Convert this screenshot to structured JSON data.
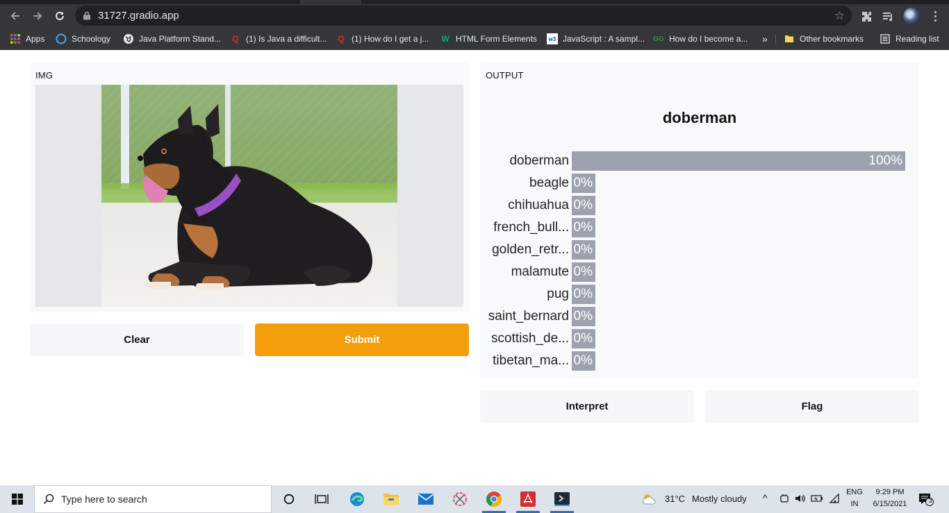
{
  "browser": {
    "url": "31727.gradio.app",
    "bookmarks": [
      {
        "label": "Apps",
        "icon": "apps-grid-icon"
      },
      {
        "label": "Schoology",
        "icon": "schoology-icon"
      },
      {
        "label": "Java Platform Stand...",
        "icon": "globe-icon"
      },
      {
        "label": "(1) Is Java a difficult...",
        "icon": "quora-icon"
      },
      {
        "label": "(1) How do I get a j...",
        "icon": "quora-icon"
      },
      {
        "label": "HTML Form Elements",
        "icon": "w3-icon"
      },
      {
        "label": "JavaScript : A sampl...",
        "icon": "w3c-icon"
      },
      {
        "label": "How do I become a...",
        "icon": "gfg-icon"
      },
      {
        "label": "»",
        "icon": "overflow-chevron"
      },
      {
        "label": "Other bookmarks",
        "icon": "folder-icon"
      },
      {
        "label": "Reading list",
        "icon": "reading-list-icon"
      }
    ]
  },
  "app": {
    "input_label": "IMG",
    "output_label": "OUTPUT",
    "clear_label": "Clear",
    "submit_label": "Submit",
    "interpret_label": "Interpret",
    "flag_label": "Flag",
    "prediction": "doberman",
    "confidences": [
      {
        "label": "doberman",
        "value": 1.0,
        "text": "100%"
      },
      {
        "label": "beagle",
        "value": 0.0,
        "text": "0%"
      },
      {
        "label": "chihuahua",
        "value": 0.0,
        "text": "0%"
      },
      {
        "label": "french_bull...",
        "value": 0.0,
        "text": "0%"
      },
      {
        "label": "golden_retr...",
        "value": 0.0,
        "text": "0%"
      },
      {
        "label": "malamute",
        "value": 0.0,
        "text": "0%"
      },
      {
        "label": "pug",
        "value": 0.0,
        "text": "0%"
      },
      {
        "label": "saint_bernard",
        "value": 0.0,
        "text": "0%"
      },
      {
        "label": "scottish_de...",
        "value": 0.0,
        "text": "0%"
      },
      {
        "label": "tibetan_ma...",
        "value": 0.0,
        "text": "0%"
      }
    ]
  },
  "taskbar": {
    "search_placeholder": "Type here to search",
    "weather_temp": "31°C",
    "weather_text": "Mostly cloudy",
    "lang": "ENG",
    "region": "IN",
    "time": "9:29 PM",
    "date": "6/15/2021",
    "notification_count": "3"
  },
  "colors": {
    "submit": "#f59e0b",
    "bar": "#9ca3af",
    "chrome_dark": "#35363a"
  }
}
